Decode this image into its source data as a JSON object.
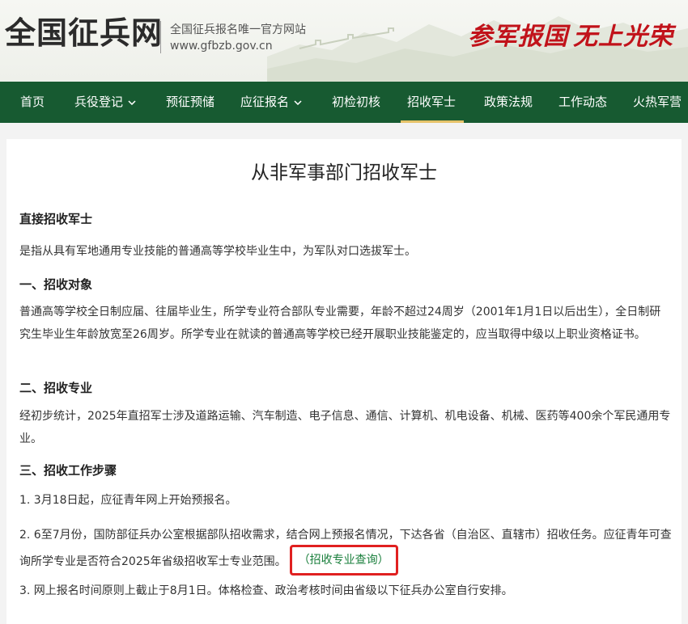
{
  "header": {
    "logo": "全国征兵网",
    "tagline": "全国征兵报名唯一官方网站",
    "url": "www.gfbzb.gov.cn",
    "slogan_left": "参军报国",
    "slogan_right": "无上光荣"
  },
  "nav": {
    "items": [
      {
        "label": "首页"
      },
      {
        "label": "兵役登记"
      },
      {
        "label": "预征预储"
      },
      {
        "label": "应征报名"
      },
      {
        "label": "初检初核"
      },
      {
        "label": "招收军士"
      },
      {
        "label": "政策法规"
      },
      {
        "label": "工作动态"
      },
      {
        "label": "火热军营"
      }
    ]
  },
  "article": {
    "title": "从非军事部门招收军士",
    "intro_heading": "直接招收军士",
    "intro_text": "是指从具有军地通用专业技能的普通高等学校毕业生中，为军队对口选拔军士。",
    "section1_heading": "一、招收对象",
    "section1_text": "普通高等学校全日制应届、往届毕业生，所学专业符合部队专业需要，年龄不超过24周岁（2001年1月1日以后出生），全日制研究生毕业生年龄放宽至26周岁。所学专业在就读的普通高等学校已经开展职业技能鉴定的，应当取得中级以上职业资格证书。",
    "section2_heading": "二、招收专业",
    "section2_text": "经初步统计，2025年直招军士涉及道路运输、汽车制造、电子信息、通信、计算机、机电设备、机械、医药等400余个军民通用专业。",
    "section3_heading": "三、招收工作步骤",
    "step1": "1. 3月18日起，应征青年网上开始预报名。",
    "step2": "2. 6至7月份，国防部征兵办公室根据部队招收需求，结合网上预报名情况，下达各省（自治区、直辖市）招收任务。应征青年可查询所学专业是否符合2025年省级招收军士专业范围。",
    "step2_link": "（招收专业查询）",
    "step3": "3. 网上报名时间原则上截止于8月1日。体格检查、政治考核时间由省级以下征兵办公室自行安排。"
  }
}
